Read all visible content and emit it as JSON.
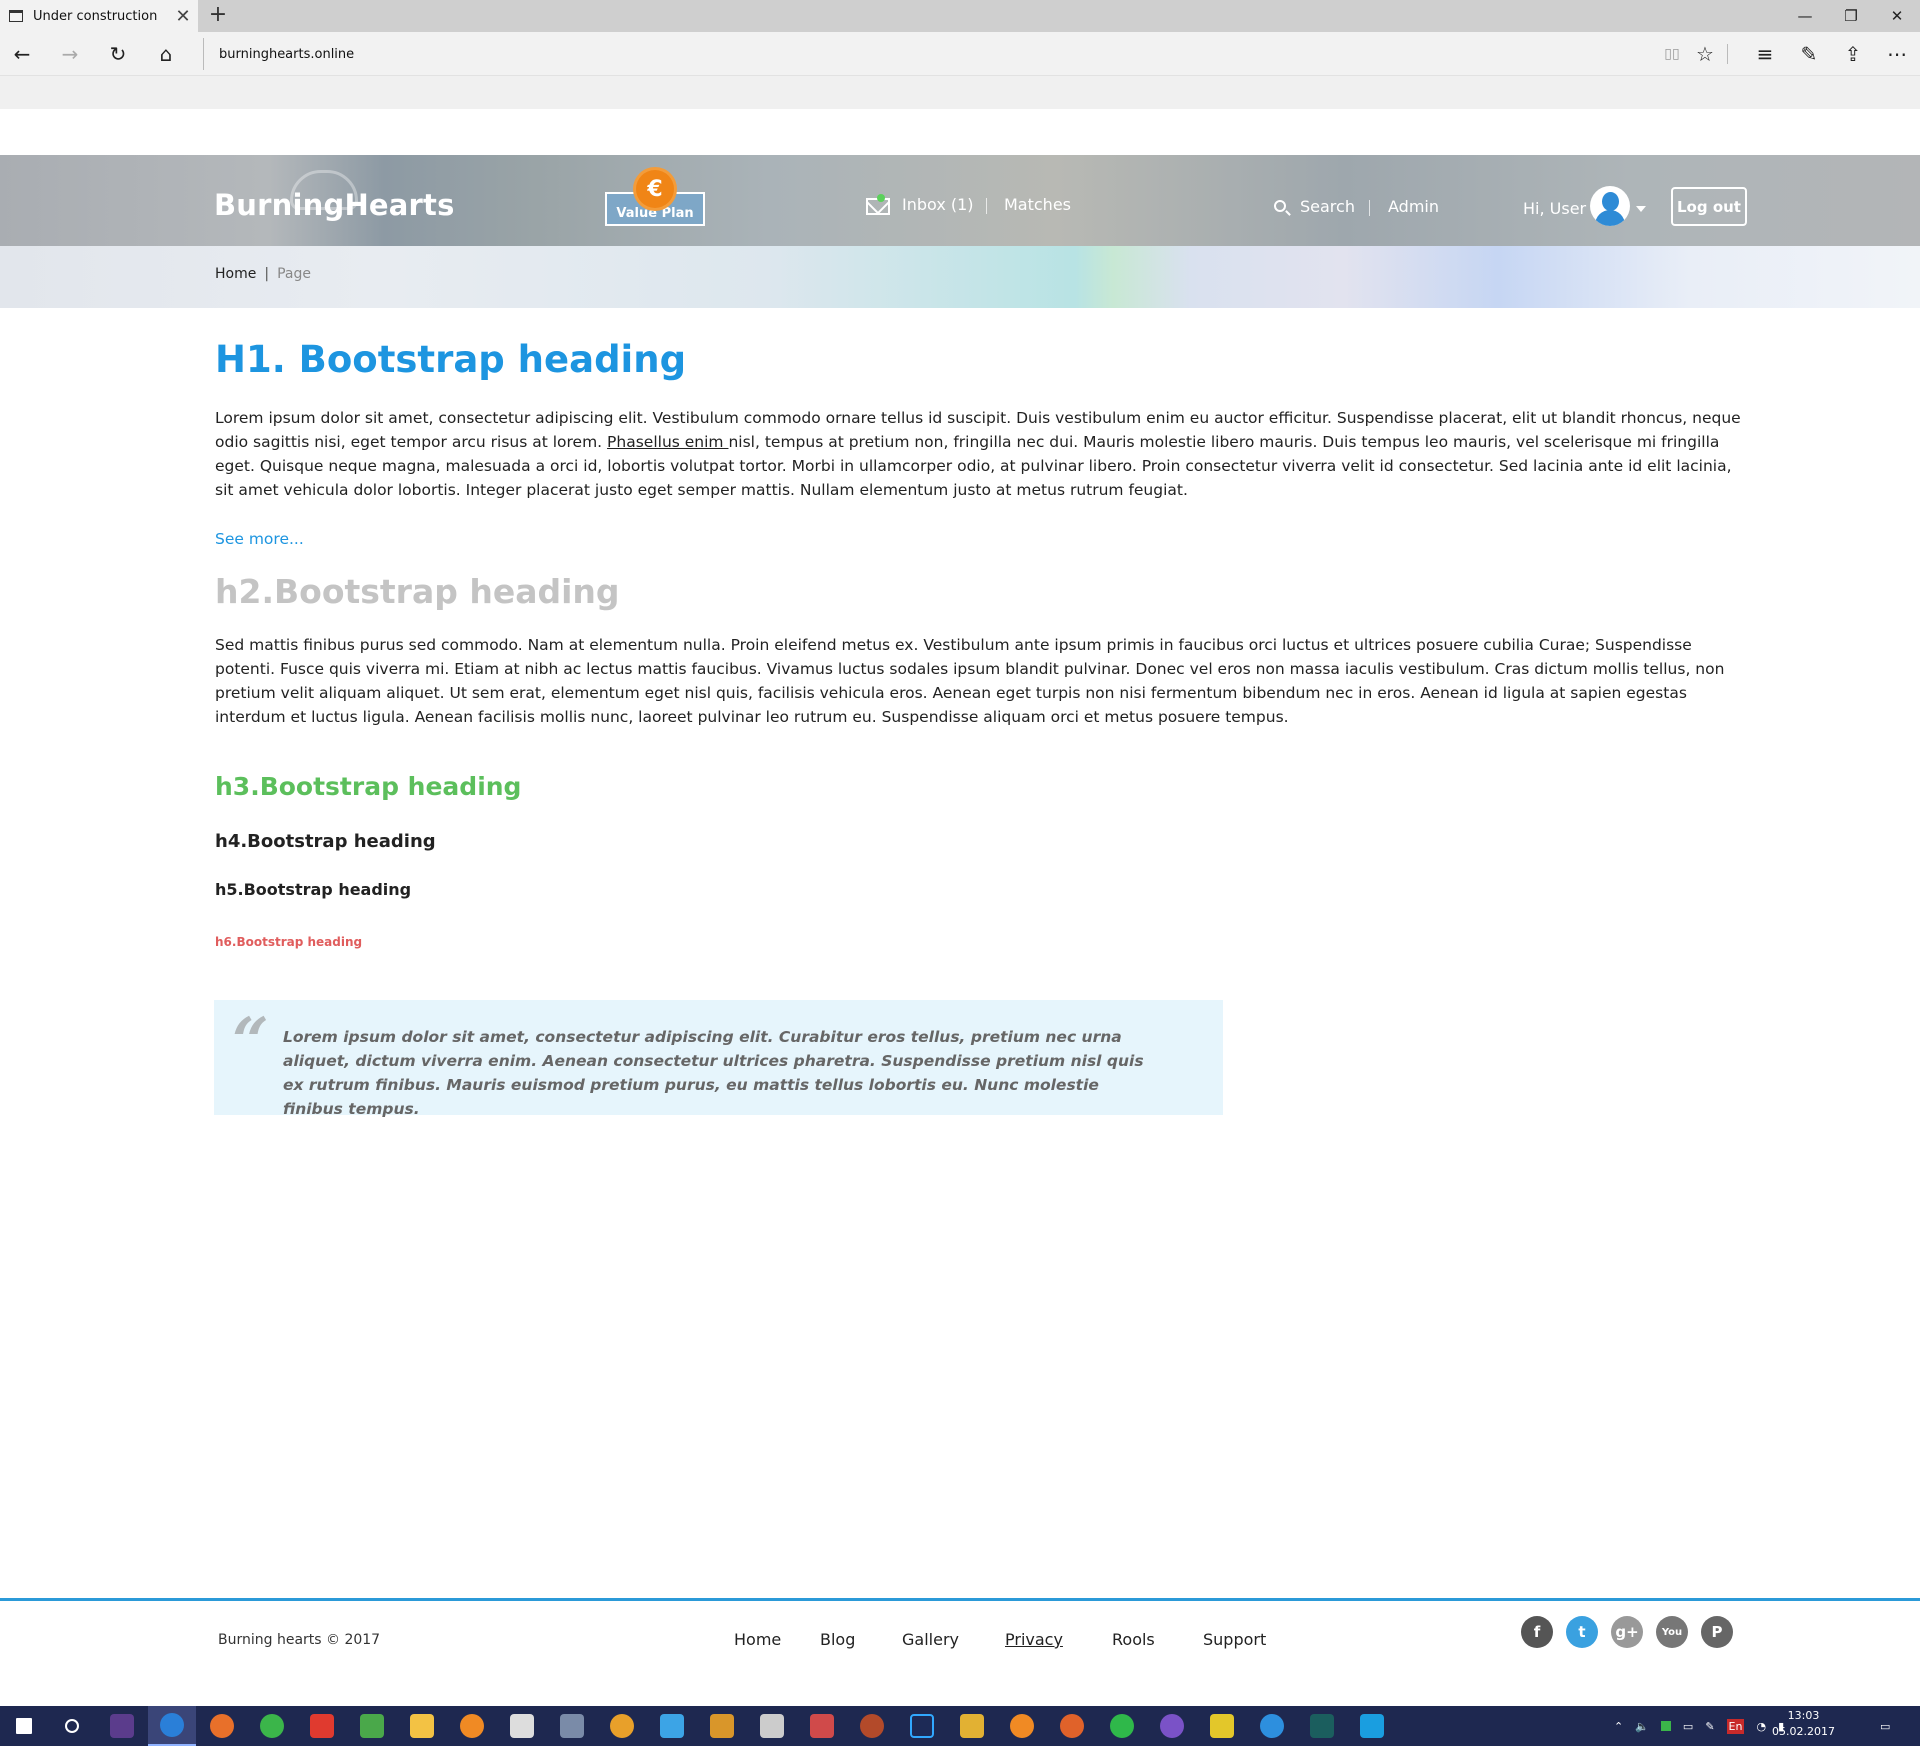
{
  "browser": {
    "tab_title": "Under construction",
    "tab_close": "✕",
    "new_tab": "+",
    "window_controls": {
      "minimize": "—",
      "restore": "❐",
      "close": "✕"
    },
    "url": "burninghearts.online",
    "nav": {
      "back": "←",
      "forward": "→",
      "refresh": "↻",
      "home": "⌂"
    },
    "toolbar": {
      "reading": "▯▯",
      "favorite": "☆",
      "hub": "≡",
      "notes": "✎",
      "share": "⇪",
      "more": "⋯"
    }
  },
  "header": {
    "logo": "BurningHearts",
    "value_plan": {
      "label": "Value Plan",
      "badge": "€"
    },
    "inbox": "Inbox (1)",
    "matches": "Matches",
    "search": "Search",
    "admin": "Admin",
    "greeting": "Hi, User",
    "logout": "Log out"
  },
  "breadcrumb": {
    "home": "Home",
    "separator": "|",
    "current": "Page"
  },
  "main": {
    "h1": "H1. Bootstrap heading",
    "para1_before": "Lorem ipsum dolor sit amet, consectetur adipiscing elit. Vestibulum commodo ornare tellus id suscipit. Duis vestibulum enim eu auctor efficitur. Suspendisse placerat, elit ut blandit rhoncus, neque odio sagittis nisi, eget tempor arcu risus at lorem. ",
    "para1_link": "Phasellus enim ",
    "para1_after": "nisl, tempus at pretium non, fringilla nec dui. Mauris molestie libero mauris. Duis tempus leo mauris, vel scelerisque mi fringilla eget. Quisque neque magna, malesuada a orci id, lobortis volutpat tortor. Morbi in ullamcorper odio, at pulvinar libero. Proin consectetur viverra velit id consectetur. Sed lacinia ante id elit lacinia, sit amet vehicula dolor lobortis. Integer placerat justo eget semper mattis. Nullam elementum justo at metus rutrum feugiat.",
    "see_more": "See more...",
    "h2": "h2.Bootstrap heading",
    "para2": "Sed mattis finibus purus sed commodo. Nam at elementum nulla. Proin eleifend metus ex. Vestibulum ante ipsum primis in faucibus orci luctus et ultrices posuere cubilia Curae; Suspendisse potenti. Fusce quis viverra mi. Etiam at nibh ac lectus mattis faucibus. Vivamus luctus sodales ipsum blandit pulvinar. Donec vel eros non massa iaculis vestibulum. Cras dictum mollis tellus, non pretium velit aliquam aliquet. Ut sem erat, elementum eget nisl quis, facilisis vehicula eros. Aenean eget turpis non nisi fermentum bibendum nec in eros. Aenean id ligula at sapien egestas interdum et luctus ligula. Aenean facilisis mollis nunc, laoreet pulvinar leo rutrum eu. Suspendisse aliquam orci et metus posuere tempus.",
    "h3": "h3.Bootstrap heading",
    "h4": "h4.Bootstrap heading",
    "h5": "h5.Bootstrap heading",
    "h6": "h6.Bootstrap heading",
    "quote_mark": "“",
    "quote": "Lorem ipsum dolor sit amet, consectetur adipiscing elit. Curabitur eros tellus, pretium nec urna aliquet, dictum viverra enim. Aenean consectetur ultrices pharetra. Suspendisse pretium nisl quis ex rutrum finibus. Mauris euismod pretium purus, eu mattis tellus lobortis eu. Nunc molestie finibus tempus."
  },
  "footer": {
    "copyright": "Burning hearts © 2017",
    "links": [
      "Home",
      "Blog",
      "Gallery",
      "Privacy",
      "Rools",
      "Support"
    ],
    "social": [
      {
        "name": "facebook-icon",
        "glyph": "f",
        "color": "#555555"
      },
      {
        "name": "twitter-icon",
        "glyph": "t",
        "color": "#3aa1e0"
      },
      {
        "name": "google-plus-icon",
        "glyph": "g+",
        "color": "#999999"
      },
      {
        "name": "youtube-icon",
        "glyph": "You",
        "color": "#777777"
      },
      {
        "name": "pinterest-icon",
        "glyph": "P",
        "color": "#666666"
      }
    ]
  },
  "taskbar": {
    "time": "13:03",
    "date": "05.02.2017",
    "lang": "En",
    "colors": {
      "accent": "#1d95e0",
      "h3_green": "#5cbf5c",
      "h6_red": "#e05d5d",
      "footer_line": "#2b9ad8"
    }
  }
}
